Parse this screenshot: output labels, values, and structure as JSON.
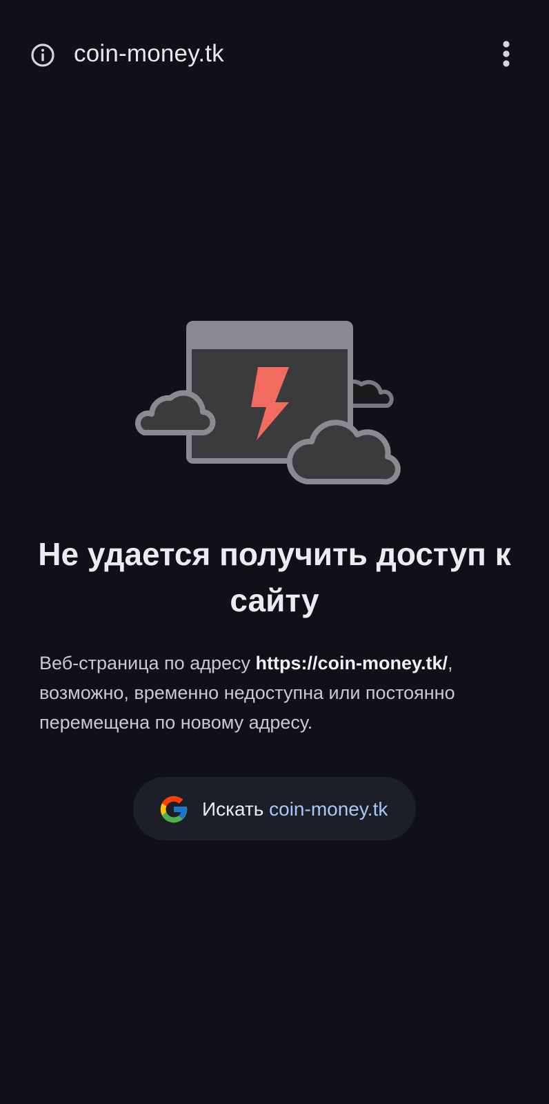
{
  "toolbar": {
    "url": "coin-money.tk",
    "info_icon": "info-icon",
    "menu_icon": "more-vert-icon"
  },
  "illustration": {
    "icon": "site-unreachable-cloud-icon",
    "bolt_color": "#f16b5f"
  },
  "error": {
    "title": "Не удается получить доступ к сайту",
    "message_before": "Веб-страница по адресу ",
    "message_url": "https://coin-money.tk/",
    "message_after": ", возможно, временно недоступна или постоянно перемещена по новому адресу."
  },
  "search": {
    "icon": "google-icon",
    "label": "Искать",
    "term": "coin-money.tk",
    "term_color": "#a8c7fa"
  }
}
